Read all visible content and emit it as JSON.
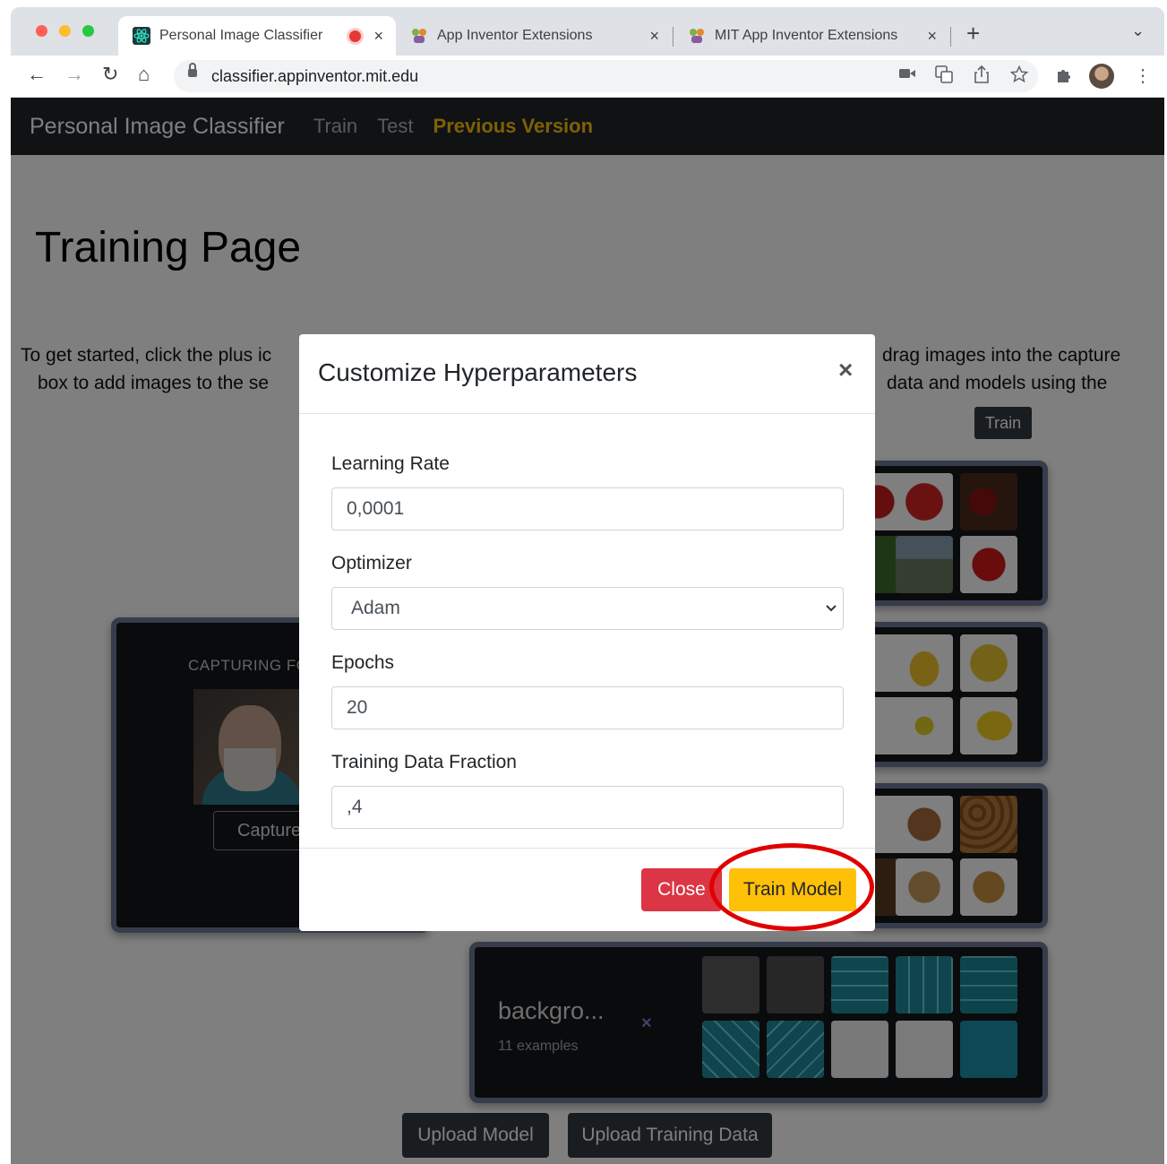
{
  "browser": {
    "tabs": [
      {
        "title": "Personal Image Classifier",
        "close": "×"
      },
      {
        "title": "App Inventor Extensions",
        "close": "×"
      },
      {
        "title": "MIT App Inventor Extensions",
        "close": "×"
      }
    ],
    "new_tab": "+",
    "tab_menu": "⌄",
    "url": "classifier.appinventor.mit.edu",
    "nav": {
      "back": "←",
      "forward": "→",
      "reload": "↻",
      "home": "⌂"
    }
  },
  "navbar": {
    "brand": "Personal Image Classifier",
    "links": [
      "Train",
      "Test",
      "Previous Version"
    ]
  },
  "page": {
    "title": "Training Page",
    "intro_left_1": "To get started, click the plus ic",
    "intro_left_2": "box to add images to the se",
    "intro_right_1": "drag images into the capture",
    "intro_right_2": "data and models using the",
    "train_button": "Train"
  },
  "capture": {
    "label": "CAPTURING FO",
    "button": "Capture"
  },
  "background_class": {
    "label": "backgro...",
    "count": "11 examples",
    "delete": "×"
  },
  "bottom_buttons": {
    "upload_model": "Upload Model",
    "upload_training_data": "Upload Training Data"
  },
  "modal": {
    "title": "Customize Hyperparameters",
    "close_icon": "×",
    "learning_rate_label": "Learning Rate",
    "learning_rate_value": "0,0001",
    "optimizer_label": "Optimizer",
    "optimizer_value": "Adam",
    "epochs_label": "Epochs",
    "epochs_value": "20",
    "fraction_label": "Training Data Fraction",
    "fraction_value": ",4",
    "close_button": "Close",
    "train_button": "Train Model"
  },
  "colors": {
    "navbar": "#212529",
    "accent_yellow": "#ffc107",
    "danger_red": "#dc3545",
    "highlight_ring": "#e00000",
    "card_border": "#6f7896"
  }
}
